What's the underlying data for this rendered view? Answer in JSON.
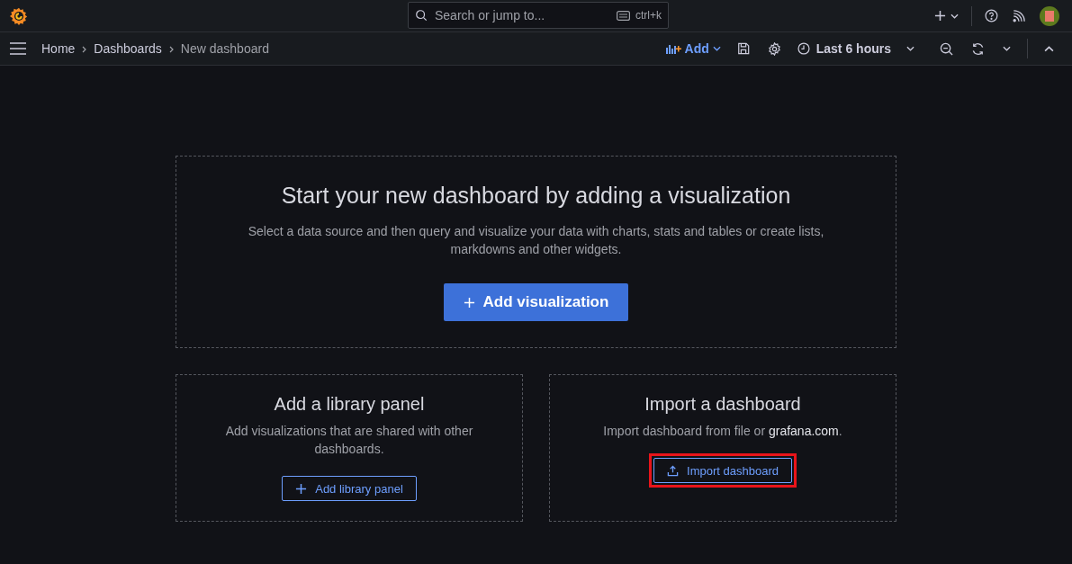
{
  "top_bar": {
    "search": {
      "placeholder": "Search or jump to...",
      "shortcut": "ctrl+k"
    }
  },
  "toolbar": {
    "breadcrumbs": [
      {
        "label": "Home",
        "current": false
      },
      {
        "label": "Dashboards",
        "current": false
      },
      {
        "label": "New dashboard",
        "current": true
      }
    ],
    "add_label": "Add",
    "time_range": "Last 6 hours"
  },
  "hero": {
    "title": "Start your new dashboard by adding a visualization",
    "description": "Select a data source and then query and visualize your data with charts, stats and tables or create lists, markdowns and other widgets.",
    "button": "Add visualization"
  },
  "cards": [
    {
      "kind": "library",
      "title": "Add a library panel",
      "description": "Add visualizations that are shared with other dashboards.",
      "button": "Add library panel",
      "highlighted": false
    },
    {
      "kind": "import",
      "title": "Import a dashboard",
      "description": "Import dashboard from file or ",
      "link": "grafana.com",
      "description_end": ".",
      "button": "Import dashboard",
      "highlighted": true
    }
  ]
}
